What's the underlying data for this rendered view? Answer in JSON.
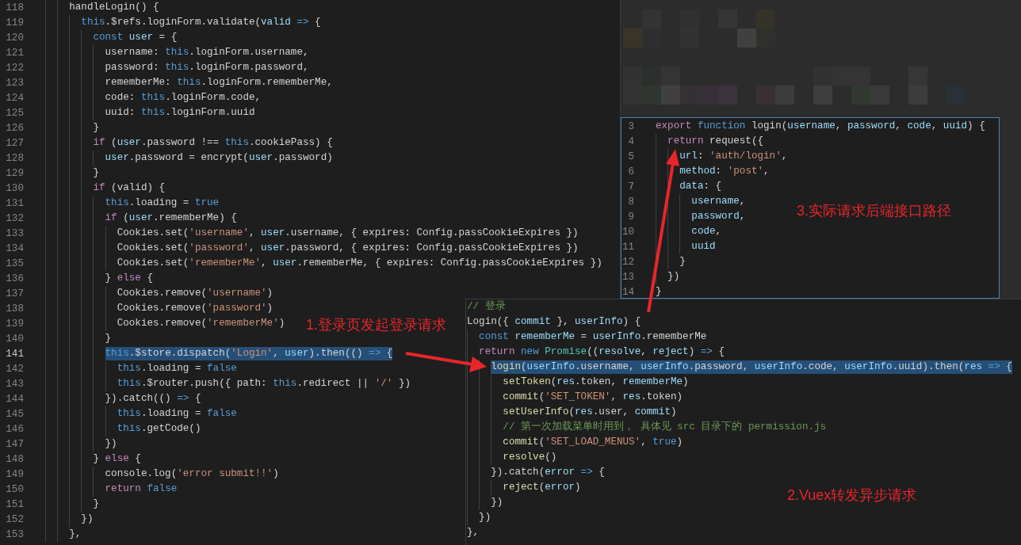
{
  "editor": {
    "lines": [
      {
        "number": "118",
        "selected": false,
        "tokens": [
          {
            "kind": "plain",
            "text": "    handleLogin() {"
          }
        ]
      },
      {
        "number": "119",
        "selected": false,
        "tokens": [
          {
            "kind": "storage",
            "text": "      this"
          },
          {
            "kind": "plain",
            "text": ".$refs.loginForm.validate("
          },
          {
            "kind": "variable",
            "text": "valid "
          },
          {
            "kind": "storage",
            "text": "=>"
          },
          {
            "kind": "plain",
            "text": " {"
          }
        ]
      },
      {
        "number": "120",
        "selected": false,
        "tokens": [
          {
            "kind": "storage",
            "text": "        const "
          },
          {
            "kind": "variable",
            "text": "user"
          },
          {
            "kind": "plain",
            "text": " = {"
          }
        ]
      },
      {
        "number": "121",
        "selected": false,
        "tokens": [
          {
            "kind": "plain",
            "text": "          username: "
          },
          {
            "kind": "storage",
            "text": "this"
          },
          {
            "kind": "plain",
            "text": ".loginForm.username,"
          }
        ]
      },
      {
        "number": "122",
        "selected": false,
        "tokens": [
          {
            "kind": "plain",
            "text": "          password: "
          },
          {
            "kind": "storage",
            "text": "this"
          },
          {
            "kind": "plain",
            "text": ".loginForm.password,"
          }
        ]
      },
      {
        "number": "123",
        "selected": false,
        "tokens": [
          {
            "kind": "plain",
            "text": "          rememberMe: "
          },
          {
            "kind": "storage",
            "text": "this"
          },
          {
            "kind": "plain",
            "text": ".loginForm.rememberMe,"
          }
        ]
      },
      {
        "number": "124",
        "selected": false,
        "tokens": [
          {
            "kind": "plain",
            "text": "          code: "
          },
          {
            "kind": "storage",
            "text": "this"
          },
          {
            "kind": "plain",
            "text": ".loginForm.code,"
          }
        ]
      },
      {
        "number": "125",
        "selected": false,
        "tokens": [
          {
            "kind": "plain",
            "text": "          uuid: "
          },
          {
            "kind": "storage",
            "text": "this"
          },
          {
            "kind": "plain",
            "text": ".loginForm.uuid"
          }
        ]
      },
      {
        "number": "126",
        "selected": false,
        "tokens": [
          {
            "kind": "plain",
            "text": "        }"
          }
        ]
      },
      {
        "number": "127",
        "selected": false,
        "tokens": [
          {
            "kind": "keyword",
            "text": "        if"
          },
          {
            "kind": "plain",
            "text": " ("
          },
          {
            "kind": "variable",
            "text": "user"
          },
          {
            "kind": "plain",
            "text": ".password !== "
          },
          {
            "kind": "storage",
            "text": "this"
          },
          {
            "kind": "plain",
            "text": ".cookiePass) {"
          }
        ]
      },
      {
        "number": "128",
        "selected": false,
        "tokens": [
          {
            "kind": "variable",
            "text": "          user"
          },
          {
            "kind": "plain",
            "text": ".password = encrypt("
          },
          {
            "kind": "variable",
            "text": "user"
          },
          {
            "kind": "plain",
            "text": ".password)"
          }
        ]
      },
      {
        "number": "129",
        "selected": false,
        "tokens": [
          {
            "kind": "plain",
            "text": "        }"
          }
        ]
      },
      {
        "number": "130",
        "selected": false,
        "tokens": [
          {
            "kind": "keyword",
            "text": "        if"
          },
          {
            "kind": "plain",
            "text": " (valid) {"
          }
        ]
      },
      {
        "number": "131",
        "selected": false,
        "tokens": [
          {
            "kind": "storage",
            "text": "          this"
          },
          {
            "kind": "plain",
            "text": ".loading = "
          },
          {
            "kind": "storage",
            "text": "true"
          }
        ]
      },
      {
        "number": "132",
        "selected": false,
        "tokens": [
          {
            "kind": "keyword",
            "text": "          if"
          },
          {
            "kind": "plain",
            "text": " ("
          },
          {
            "kind": "variable",
            "text": "user"
          },
          {
            "kind": "plain",
            "text": ".rememberMe) {"
          }
        ]
      },
      {
        "number": "133",
        "selected": false,
        "tokens": [
          {
            "kind": "plain",
            "text": "            Cookies.set("
          },
          {
            "kind": "string",
            "text": "'username'"
          },
          {
            "kind": "plain",
            "text": ", "
          },
          {
            "kind": "variable",
            "text": "user"
          },
          {
            "kind": "plain",
            "text": ".username, { expires: Config.passCookieExpires })"
          }
        ]
      },
      {
        "number": "134",
        "selected": false,
        "tokens": [
          {
            "kind": "plain",
            "text": "            Cookies.set("
          },
          {
            "kind": "string",
            "text": "'password'"
          },
          {
            "kind": "plain",
            "text": ", "
          },
          {
            "kind": "variable",
            "text": "user"
          },
          {
            "kind": "plain",
            "text": ".password, { expires: Config.passCookieExpires })"
          }
        ]
      },
      {
        "number": "135",
        "selected": false,
        "tokens": [
          {
            "kind": "plain",
            "text": "            Cookies.set("
          },
          {
            "kind": "string",
            "text": "'rememberMe'"
          },
          {
            "kind": "plain",
            "text": ", "
          },
          {
            "kind": "variable",
            "text": "user"
          },
          {
            "kind": "plain",
            "text": ".rememberMe, { expires: Config.passCookieExpires })"
          }
        ]
      },
      {
        "number": "136",
        "selected": false,
        "tokens": [
          {
            "kind": "plain",
            "text": "          } "
          },
          {
            "kind": "keyword",
            "text": "else"
          },
          {
            "kind": "plain",
            "text": " {"
          }
        ]
      },
      {
        "number": "137",
        "selected": false,
        "tokens": [
          {
            "kind": "plain",
            "text": "            Cookies.remove("
          },
          {
            "kind": "string",
            "text": "'username'"
          },
          {
            "kind": "plain",
            "text": ")"
          }
        ]
      },
      {
        "number": "138",
        "selected": false,
        "tokens": [
          {
            "kind": "plain",
            "text": "            Cookies.remove("
          },
          {
            "kind": "string",
            "text": "'password'"
          },
          {
            "kind": "plain",
            "text": ")"
          }
        ]
      },
      {
        "number": "139",
        "selected": false,
        "tokens": [
          {
            "kind": "plain",
            "text": "            Cookies.remove("
          },
          {
            "kind": "string",
            "text": "'rememberMe'"
          },
          {
            "kind": "plain",
            "text": ")"
          }
        ]
      },
      {
        "number": "140",
        "selected": false,
        "tokens": [
          {
            "kind": "plain",
            "text": "          }"
          }
        ]
      },
      {
        "number": "141",
        "selected": true,
        "tokens": [
          {
            "kind": "storage",
            "text": "          this"
          },
          {
            "kind": "plain",
            "text": ".$store.dispatch("
          },
          {
            "kind": "string",
            "text": "'Login'"
          },
          {
            "kind": "plain",
            "text": ", "
          },
          {
            "kind": "variable",
            "text": "user"
          },
          {
            "kind": "plain",
            "text": ").then(() "
          },
          {
            "kind": "storage",
            "text": "=>"
          },
          {
            "kind": "plain",
            "text": " {"
          }
        ]
      },
      {
        "number": "142",
        "selected": false,
        "tokens": [
          {
            "kind": "storage",
            "text": "            this"
          },
          {
            "kind": "plain",
            "text": ".loading = "
          },
          {
            "kind": "storage",
            "text": "false"
          }
        ]
      },
      {
        "number": "143",
        "selected": false,
        "tokens": [
          {
            "kind": "storage",
            "text": "            this"
          },
          {
            "kind": "plain",
            "text": ".$router.push({ path: "
          },
          {
            "kind": "storage",
            "text": "this"
          },
          {
            "kind": "plain",
            "text": ".redirect || "
          },
          {
            "kind": "string",
            "text": "'/'"
          },
          {
            "kind": "plain",
            "text": " })"
          }
        ]
      },
      {
        "number": "144",
        "selected": false,
        "tokens": [
          {
            "kind": "plain",
            "text": "          }).catch(() "
          },
          {
            "kind": "storage",
            "text": "=>"
          },
          {
            "kind": "plain",
            "text": " {"
          }
        ]
      },
      {
        "number": "145",
        "selected": false,
        "tokens": [
          {
            "kind": "storage",
            "text": "            this"
          },
          {
            "kind": "plain",
            "text": ".loading = "
          },
          {
            "kind": "storage",
            "text": "false"
          }
        ]
      },
      {
        "number": "146",
        "selected": false,
        "tokens": [
          {
            "kind": "storage",
            "text": "            this"
          },
          {
            "kind": "plain",
            "text": ".getCode()"
          }
        ]
      },
      {
        "number": "147",
        "selected": false,
        "tokens": [
          {
            "kind": "plain",
            "text": "          })"
          }
        ]
      },
      {
        "number": "148",
        "selected": false,
        "tokens": [
          {
            "kind": "plain",
            "text": "        } "
          },
          {
            "kind": "keyword",
            "text": "else"
          },
          {
            "kind": "plain",
            "text": " {"
          }
        ]
      },
      {
        "number": "149",
        "selected": false,
        "tokens": [
          {
            "kind": "plain",
            "text": "          console.log("
          },
          {
            "kind": "string",
            "text": "'error submit!!'"
          },
          {
            "kind": "plain",
            "text": ")"
          }
        ]
      },
      {
        "number": "150",
        "selected": false,
        "tokens": [
          {
            "kind": "keyword",
            "text": "          return "
          },
          {
            "kind": "storage",
            "text": "false"
          }
        ]
      },
      {
        "number": "151",
        "selected": false,
        "tokens": [
          {
            "kind": "plain",
            "text": "        }"
          }
        ]
      },
      {
        "number": "152",
        "selected": false,
        "tokens": [
          {
            "kind": "plain",
            "text": "      })"
          }
        ]
      },
      {
        "number": "153",
        "selected": false,
        "tokens": [
          {
            "kind": "plain",
            "text": "    },"
          }
        ]
      }
    ]
  },
  "api_snippet": {
    "lines": [
      {
        "number": "3",
        "selected": false,
        "tokens": [
          {
            "kind": "keyword",
            "text": "export "
          },
          {
            "kind": "storage",
            "text": "function"
          },
          {
            "kind": "plain",
            "text": " login("
          },
          {
            "kind": "variable",
            "text": "username"
          },
          {
            "kind": "plain",
            "text": ", "
          },
          {
            "kind": "variable",
            "text": "password"
          },
          {
            "kind": "plain",
            "text": ", "
          },
          {
            "kind": "variable",
            "text": "code"
          },
          {
            "kind": "plain",
            "text": ", "
          },
          {
            "kind": "variable",
            "text": "uuid"
          },
          {
            "kind": "plain",
            "text": ") {"
          }
        ]
      },
      {
        "number": "4",
        "selected": false,
        "tokens": [
          {
            "kind": "keyword",
            "text": "  return"
          },
          {
            "kind": "plain",
            "text": " request({"
          }
        ]
      },
      {
        "number": "5",
        "selected": false,
        "tokens": [
          {
            "kind": "variable",
            "text": "    url"
          },
          {
            "kind": "plain",
            "text": ": "
          },
          {
            "kind": "string",
            "text": "'auth/login'"
          },
          {
            "kind": "plain",
            "text": ","
          }
        ]
      },
      {
        "number": "6",
        "selected": false,
        "tokens": [
          {
            "kind": "variable",
            "text": "    method"
          },
          {
            "kind": "plain",
            "text": ": "
          },
          {
            "kind": "string",
            "text": "'post'"
          },
          {
            "kind": "plain",
            "text": ","
          }
        ]
      },
      {
        "number": "7",
        "selected": false,
        "tokens": [
          {
            "kind": "variable",
            "text": "    data"
          },
          {
            "kind": "plain",
            "text": ": {"
          }
        ]
      },
      {
        "number": "8",
        "selected": false,
        "tokens": [
          {
            "kind": "variable",
            "text": "      username"
          },
          {
            "kind": "plain",
            "text": ","
          }
        ]
      },
      {
        "number": "9",
        "selected": false,
        "tokens": [
          {
            "kind": "variable",
            "text": "      password"
          },
          {
            "kind": "plain",
            "text": ","
          }
        ]
      },
      {
        "number": "10",
        "selected": false,
        "tokens": [
          {
            "kind": "variable",
            "text": "      code"
          },
          {
            "kind": "plain",
            "text": ","
          }
        ]
      },
      {
        "number": "11",
        "selected": false,
        "tokens": [
          {
            "kind": "variable",
            "text": "      uuid"
          }
        ]
      },
      {
        "number": "12",
        "selected": false,
        "tokens": [
          {
            "kind": "plain",
            "text": "    }"
          }
        ]
      },
      {
        "number": "13",
        "selected": false,
        "tokens": [
          {
            "kind": "plain",
            "text": "  })"
          }
        ]
      },
      {
        "number": "14",
        "selected": false,
        "tokens": [
          {
            "kind": "plain",
            "text": "}"
          }
        ]
      }
    ]
  },
  "store_snippet": {
    "lines": [
      {
        "selected": false,
        "tokens": [
          {
            "kind": "comment",
            "text": "// 登录"
          }
        ]
      },
      {
        "selected": false,
        "tokens": [
          {
            "kind": "plain",
            "text": "Login({ "
          },
          {
            "kind": "variable",
            "text": "commit"
          },
          {
            "kind": "plain",
            "text": " }, "
          },
          {
            "kind": "variable",
            "text": "userInfo"
          },
          {
            "kind": "plain",
            "text": ") {"
          }
        ]
      },
      {
        "selected": false,
        "tokens": [
          {
            "kind": "storage",
            "text": "  const "
          },
          {
            "kind": "variable",
            "text": "rememberMe"
          },
          {
            "kind": "plain",
            "text": " = "
          },
          {
            "kind": "variable",
            "text": "userInfo"
          },
          {
            "kind": "plain",
            "text": ".rememberMe"
          }
        ]
      },
      {
        "selected": false,
        "tokens": [
          {
            "kind": "keyword",
            "text": "  return "
          },
          {
            "kind": "storage",
            "text": "new "
          },
          {
            "kind": "class",
            "text": "Promise"
          },
          {
            "kind": "plain",
            "text": "(("
          },
          {
            "kind": "variable",
            "text": "resolve"
          },
          {
            "kind": "plain",
            "text": ", "
          },
          {
            "kind": "variable",
            "text": "reject"
          },
          {
            "kind": "plain",
            "text": ") "
          },
          {
            "kind": "storage",
            "text": "=>"
          },
          {
            "kind": "plain",
            "text": " {"
          }
        ]
      },
      {
        "selected": true,
        "tokens": [
          {
            "kind": "function",
            "text": "    login"
          },
          {
            "kind": "plain",
            "text": "("
          },
          {
            "kind": "variable",
            "text": "userInfo"
          },
          {
            "kind": "plain",
            "text": ".username, "
          },
          {
            "kind": "variable",
            "text": "userInfo"
          },
          {
            "kind": "plain",
            "text": ".password, "
          },
          {
            "kind": "variable",
            "text": "userInfo"
          },
          {
            "kind": "plain",
            "text": ".code, "
          },
          {
            "kind": "variable",
            "text": "userInfo"
          },
          {
            "kind": "plain",
            "text": ".uuid).then("
          },
          {
            "kind": "variable",
            "text": "res "
          },
          {
            "kind": "storage",
            "text": "=>"
          },
          {
            "kind": "plain",
            "text": " {"
          }
        ]
      },
      {
        "selected": false,
        "tokens": [
          {
            "kind": "function",
            "text": "      setToken"
          },
          {
            "kind": "plain",
            "text": "("
          },
          {
            "kind": "variable",
            "text": "res"
          },
          {
            "kind": "plain",
            "text": ".token, "
          },
          {
            "kind": "variable",
            "text": "rememberMe"
          },
          {
            "kind": "plain",
            "text": ")"
          }
        ]
      },
      {
        "selected": false,
        "tokens": [
          {
            "kind": "function",
            "text": "      commit"
          },
          {
            "kind": "plain",
            "text": "("
          },
          {
            "kind": "string",
            "text": "'SET_TOKEN'"
          },
          {
            "kind": "plain",
            "text": ", "
          },
          {
            "kind": "variable",
            "text": "res"
          },
          {
            "kind": "plain",
            "text": ".token)"
          }
        ]
      },
      {
        "selected": false,
        "tokens": [
          {
            "kind": "function",
            "text": "      setUserInfo"
          },
          {
            "kind": "plain",
            "text": "("
          },
          {
            "kind": "variable",
            "text": "res"
          },
          {
            "kind": "plain",
            "text": ".user, "
          },
          {
            "kind": "variable",
            "text": "commit"
          },
          {
            "kind": "plain",
            "text": ")"
          }
        ]
      },
      {
        "selected": false,
        "tokens": [
          {
            "kind": "comment",
            "text": "      // 第一次加载菜单时用到， 具体见 src 目录下的 permission.js"
          }
        ]
      },
      {
        "selected": false,
        "tokens": [
          {
            "kind": "function",
            "text": "      commit"
          },
          {
            "kind": "plain",
            "text": "("
          },
          {
            "kind": "string",
            "text": "'SET_LOAD_MENUS'"
          },
          {
            "kind": "plain",
            "text": ", "
          },
          {
            "kind": "storage",
            "text": "true"
          },
          {
            "kind": "plain",
            "text": ")"
          }
        ]
      },
      {
        "selected": false,
        "tokens": [
          {
            "kind": "function",
            "text": "      resolve"
          },
          {
            "kind": "plain",
            "text": "()"
          }
        ]
      },
      {
        "selected": false,
        "tokens": [
          {
            "kind": "plain",
            "text": "    }).catch("
          },
          {
            "kind": "variable",
            "text": "error "
          },
          {
            "kind": "storage",
            "text": "=>"
          },
          {
            "kind": "plain",
            "text": " {"
          }
        ]
      },
      {
        "selected": false,
        "tokens": [
          {
            "kind": "function",
            "text": "      reject"
          },
          {
            "kind": "plain",
            "text": "("
          },
          {
            "kind": "variable",
            "text": "error"
          },
          {
            "kind": "plain",
            "text": ")"
          }
        ]
      },
      {
        "selected": false,
        "tokens": [
          {
            "kind": "plain",
            "text": "    })"
          }
        ]
      },
      {
        "selected": false,
        "tokens": [
          {
            "kind": "plain",
            "text": "  })"
          }
        ]
      },
      {
        "selected": false,
        "tokens": [
          {
            "kind": "plain",
            "text": "},"
          }
        ]
      }
    ]
  },
  "annotations": [
    {
      "text": "3.实际请求后端接口路径"
    },
    {
      "text": "1.登录页发起登录请求"
    },
    {
      "text": "2.Vuex转发异步请求"
    }
  ]
}
